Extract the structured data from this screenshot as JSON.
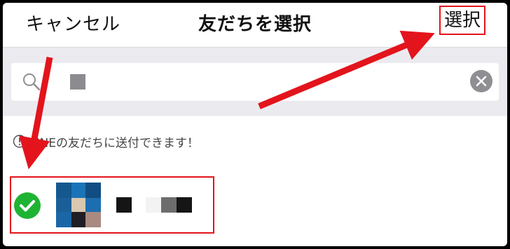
{
  "header": {
    "cancel_label": "キャンセル",
    "title": "友だちを選択",
    "select_label": "選択"
  },
  "search": {
    "value": "■"
  },
  "notice": {
    "text": "LINEの友だちに送付できます！"
  },
  "friends": [
    {
      "name": "",
      "selected": true
    }
  ],
  "colors": {
    "annotation_red": "#e3141c",
    "check_green": "#1fb333",
    "search_bg": "#ebebef"
  }
}
